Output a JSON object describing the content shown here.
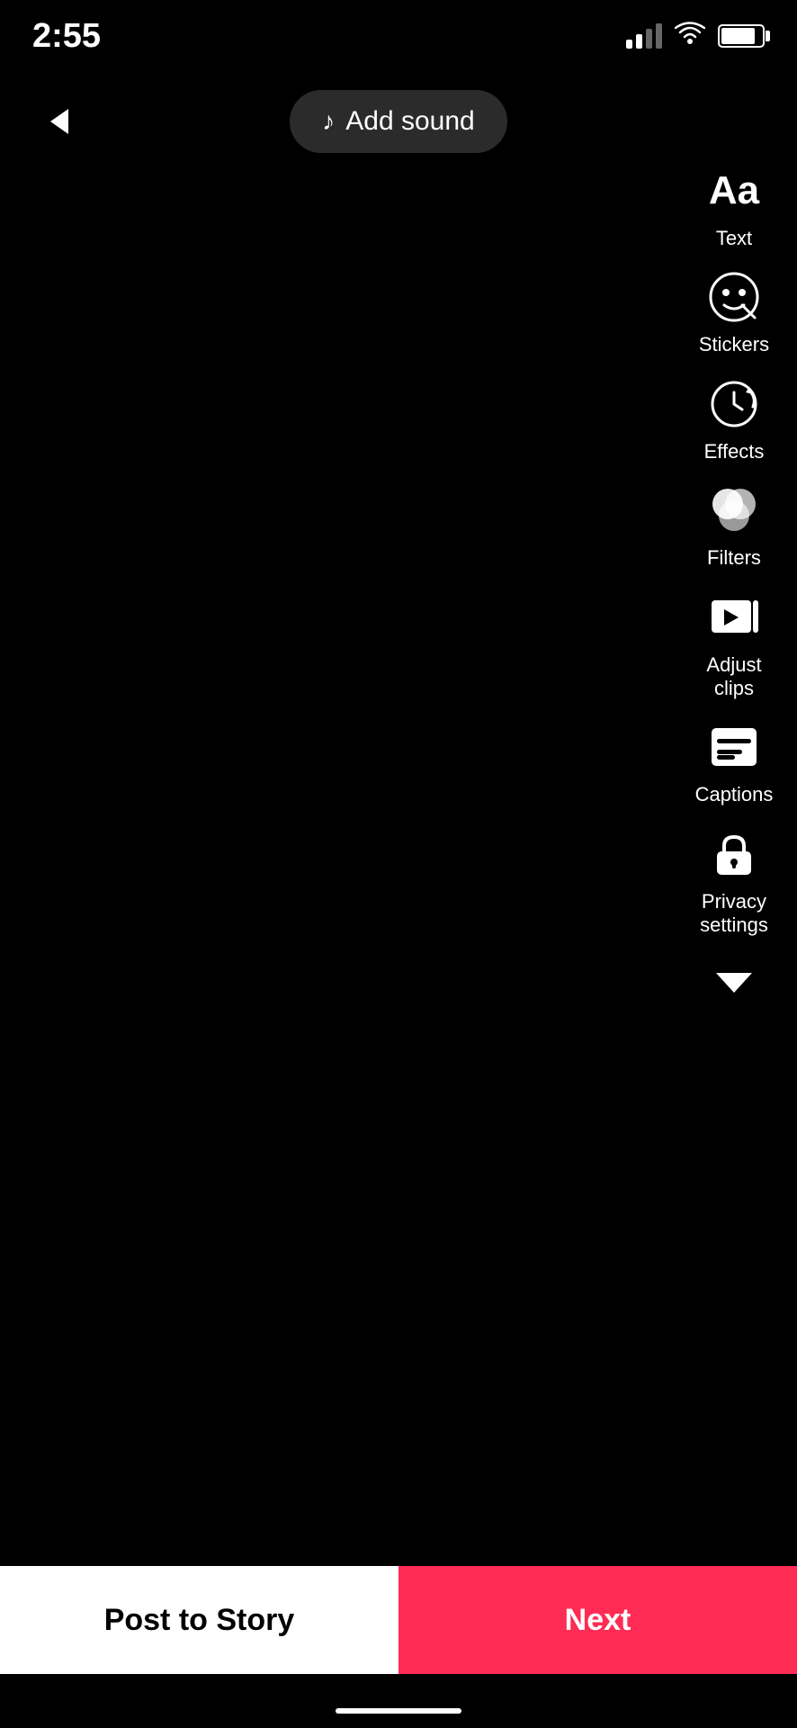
{
  "statusBar": {
    "time": "2:55",
    "signal": [
      30,
      50,
      70,
      90
    ],
    "wifi": true,
    "battery": 85
  },
  "header": {
    "backLabel": "<",
    "addSound": {
      "label": "Add sound",
      "icon": "music-note"
    }
  },
  "toolbar": {
    "items": [
      {
        "id": "text",
        "label": "Text",
        "icon": "text-icon"
      },
      {
        "id": "stickers",
        "label": "Stickers",
        "icon": "sticker-icon"
      },
      {
        "id": "effects",
        "label": "Effects",
        "icon": "effects-icon"
      },
      {
        "id": "filters",
        "label": "Filters",
        "icon": "filters-icon"
      },
      {
        "id": "adjust-clips",
        "label": "Adjust clips",
        "icon": "adjust-icon"
      },
      {
        "id": "captions",
        "label": "Captions",
        "icon": "captions-icon"
      },
      {
        "id": "privacy-settings",
        "label": "Privacy\nsettings",
        "icon": "lock-icon"
      }
    ],
    "chevronDown": "v"
  },
  "bottomBar": {
    "postToStory": "Post to Story",
    "next": "Next"
  }
}
